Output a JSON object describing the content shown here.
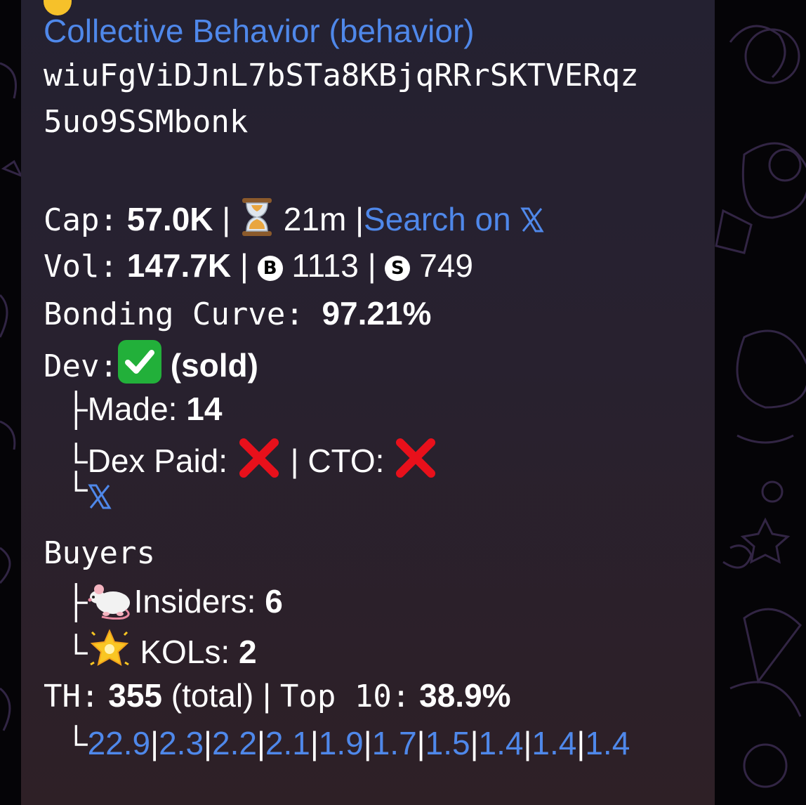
{
  "message": {
    "title": "Collective Behavior (behavior)",
    "address_line1": "wiuFgViDJnL7bSTa8KBjqRRrSKTVERqz",
    "address_line2": "5uo9SSMbonk",
    "cap": {
      "label": "Cap:",
      "value": "57.0K",
      "sep": "|",
      "age": "21m",
      "search_link": "Search on",
      "search_icon": "x-logo-icon"
    },
    "vol": {
      "label": "Vol:",
      "value": "147.7K",
      "buys_badge": "B",
      "buys": "1113",
      "sells_badge": "S",
      "sells": "749"
    },
    "bonding": {
      "label": "Bonding Curve:",
      "value": "97.21%"
    },
    "dev": {
      "label": "Dev:",
      "status": "(sold)",
      "made_label": "Made:",
      "made_value": "14",
      "dex_paid_label": "Dex Paid:",
      "cto_label": "CTO:",
      "x_link_icon": "x-logo-icon"
    },
    "buyers": {
      "label": "Buyers",
      "insiders_label": "Insiders:",
      "insiders_value": "6",
      "kols_label": "KOLs:",
      "kols_value": "2"
    },
    "holders": {
      "label": "TH:",
      "total": "355",
      "total_suffix": "(total)",
      "top10_label": "Top 10:",
      "top10_value": "38.9%",
      "top_holders": [
        "22.9",
        "2.3",
        "2.2",
        "2.1",
        "1.9",
        "1.7",
        "1.5",
        "1.4",
        "1.4",
        "1.4"
      ]
    },
    "tree_glyphs": {
      "branch": "├",
      "last": "└"
    }
  },
  "colors": {
    "link": "#4f88ea",
    "bubble_top": "#242131",
    "bubble_bottom": "#2e2026",
    "check_green": "#22b03a",
    "cross_red": "#e8101b"
  }
}
